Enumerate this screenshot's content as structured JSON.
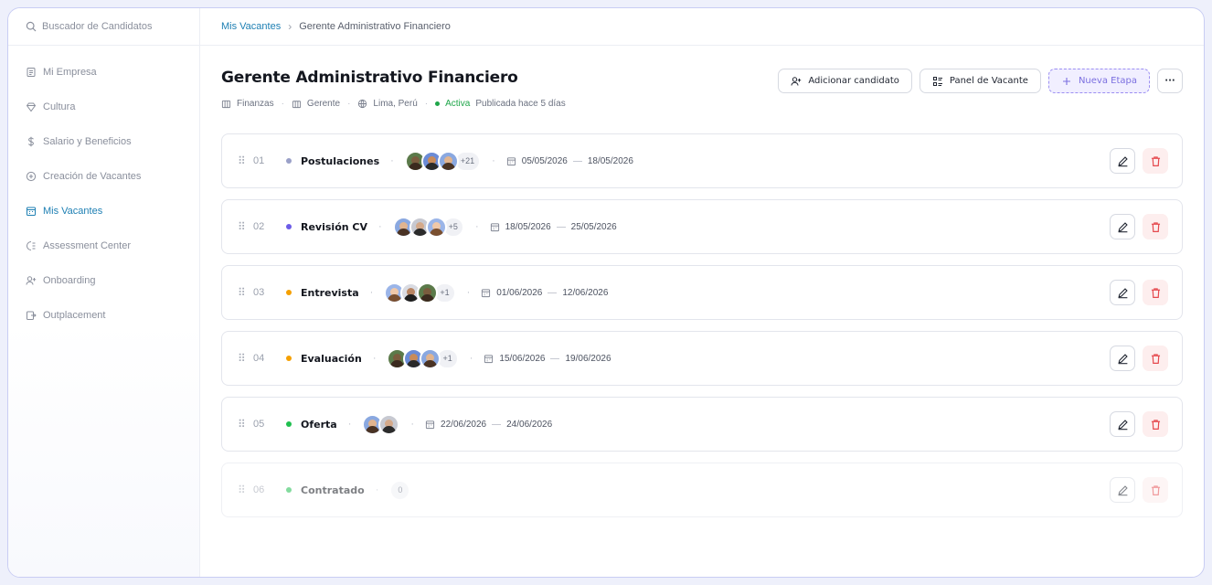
{
  "sidebar": {
    "search_label": "Buscador de Candidatos",
    "items": [
      {
        "label": "Mi Empresa",
        "icon": "document-icon",
        "active": false
      },
      {
        "label": "Cultura",
        "icon": "diamond-icon",
        "active": false
      },
      {
        "label": "Salario y Beneficios",
        "icon": "dollar-icon",
        "active": false
      },
      {
        "label": "Creación de Vacantes",
        "icon": "plus-circle-icon",
        "active": false
      },
      {
        "label": "Mis Vacantes",
        "icon": "calendar-icon",
        "active": true
      },
      {
        "label": "Assessment Center",
        "icon": "assessment-icon",
        "active": false
      },
      {
        "label": "Onboarding",
        "icon": "user-plus-icon",
        "active": false
      },
      {
        "label": "Outplacement",
        "icon": "exit-icon",
        "active": false
      }
    ]
  },
  "breadcrumb": {
    "parent": "Mis Vacantes",
    "separator": ">",
    "current": "Gerente Administrativo Financiero"
  },
  "vacancy": {
    "title": "Gerente Administrativo Financiero",
    "area": "Finanzas",
    "level": "Gerente",
    "location": "Lima, Perú",
    "status": "Activa",
    "published": "Publicada hace 5 días"
  },
  "actions": {
    "add_candidate": "Adicionar candidato",
    "panel": "Panel de Vacante",
    "new_stage": "Nueva Etapa",
    "more": "···"
  },
  "colors": {
    "accent": "#1d7fb3",
    "status_active": "#1fa64a",
    "new_stage": "#7b6fe0",
    "delete": "#e5484d"
  },
  "stages": [
    {
      "num": "01",
      "name": "Postulaciones",
      "color": "#9aa0c8",
      "avatars": 3,
      "count": "+21",
      "start": "05/05/2026",
      "end": "18/05/2026",
      "muted": false
    },
    {
      "num": "02",
      "name": "Revisión CV",
      "color": "#6c5ce7",
      "avatars": 3,
      "count": "+5",
      "start": "18/05/2026",
      "end": "25/05/2026",
      "muted": false
    },
    {
      "num": "03",
      "name": "Entrevista",
      "color": "#f5a000",
      "avatars": 3,
      "count": "+1",
      "start": "01/06/2026",
      "end": "12/06/2026",
      "muted": false
    },
    {
      "num": "04",
      "name": "Evaluación",
      "color": "#f5a000",
      "avatars": 3,
      "count": "+1",
      "start": "15/06/2026",
      "end": "19/06/2026",
      "muted": false
    },
    {
      "num": "05",
      "name": "Oferta",
      "color": "#1fbf4f",
      "avatars": 2,
      "count": "",
      "start": "22/06/2026",
      "end": "24/06/2026",
      "muted": false
    },
    {
      "num": "06",
      "name": "Contratado",
      "color": "#1fbf4f",
      "avatars": 0,
      "count": "0",
      "start": "",
      "end": "",
      "muted": true
    }
  ]
}
